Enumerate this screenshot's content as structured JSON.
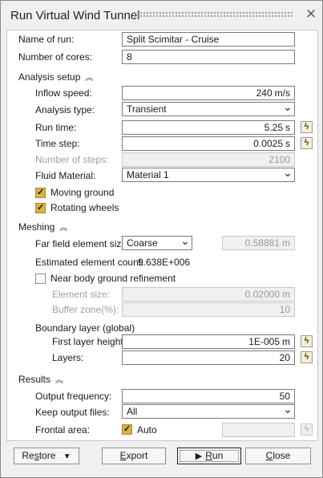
{
  "window": {
    "title": "Run Virtual Wind Tunnel"
  },
  "fields": {
    "name_label": "Name of run:",
    "name_value": "Split Scimitar - Cruise",
    "cores_label": "Number of cores:",
    "cores_value": "8"
  },
  "analysis": {
    "header": "Analysis setup",
    "inflow_label": "Inflow speed:",
    "inflow_value": "240",
    "inflow_unit": "m/s",
    "type_label": "Analysis type:",
    "type_value": "Transient",
    "runtime_label": "Run time:",
    "runtime_value": "5.25",
    "runtime_unit": "s",
    "timestep_label": "Time step:",
    "timestep_value": "0.0025",
    "timestep_unit": "s",
    "steps_label": "Number of steps:",
    "steps_value": "2100",
    "fluid_label": "Fluid Material:",
    "fluid_value": "Material 1",
    "moving_ground_label": "Moving ground",
    "moving_ground_checked": true,
    "rotating_wheels_label": "Rotating wheels",
    "rotating_wheels_checked": true
  },
  "meshing": {
    "header": "Meshing",
    "farfield_label": "Far field element size:",
    "farfield_value": "Coarse",
    "farfield_size": "0.58881",
    "farfield_unit": "m",
    "est_label": "Estimated element count:",
    "est_value": "9.638E+006",
    "nbgr_label": "Near body ground refinement",
    "nbgr_checked": false,
    "element_size_label": "Element size:",
    "element_size_value": "0.02000",
    "element_size_unit": "m",
    "buffer_label": "Buffer zone(%):",
    "buffer_value": "10",
    "boundary_label": "Boundary layer (global)",
    "first_layer_label": "First layer height:",
    "first_layer_value": "1E-005",
    "first_layer_unit": "m",
    "layers_label": "Layers:",
    "layers_value": "20"
  },
  "results": {
    "header": "Results",
    "output_freq_label": "Output frequency:",
    "output_freq_value": "50",
    "keep_files_label": "Keep output files:",
    "keep_files_value": "All",
    "frontal_label": "Frontal area:",
    "auto_label": "Auto",
    "auto_checked": true
  },
  "buttons": {
    "restore_pre": "Re",
    "restore_u": "s",
    "restore_post": "tore",
    "export_pre": "",
    "export_u": "E",
    "export_post": "xport",
    "run_pre": "",
    "run_u": "R",
    "run_post": "un",
    "close_pre": "",
    "close_u": "C",
    "close_post": "lose"
  },
  "icons": {
    "calc": "lightning-calc-icon",
    "collapse": "chevron-up-double-icon",
    "close": "close-icon",
    "run": "play-icon"
  }
}
